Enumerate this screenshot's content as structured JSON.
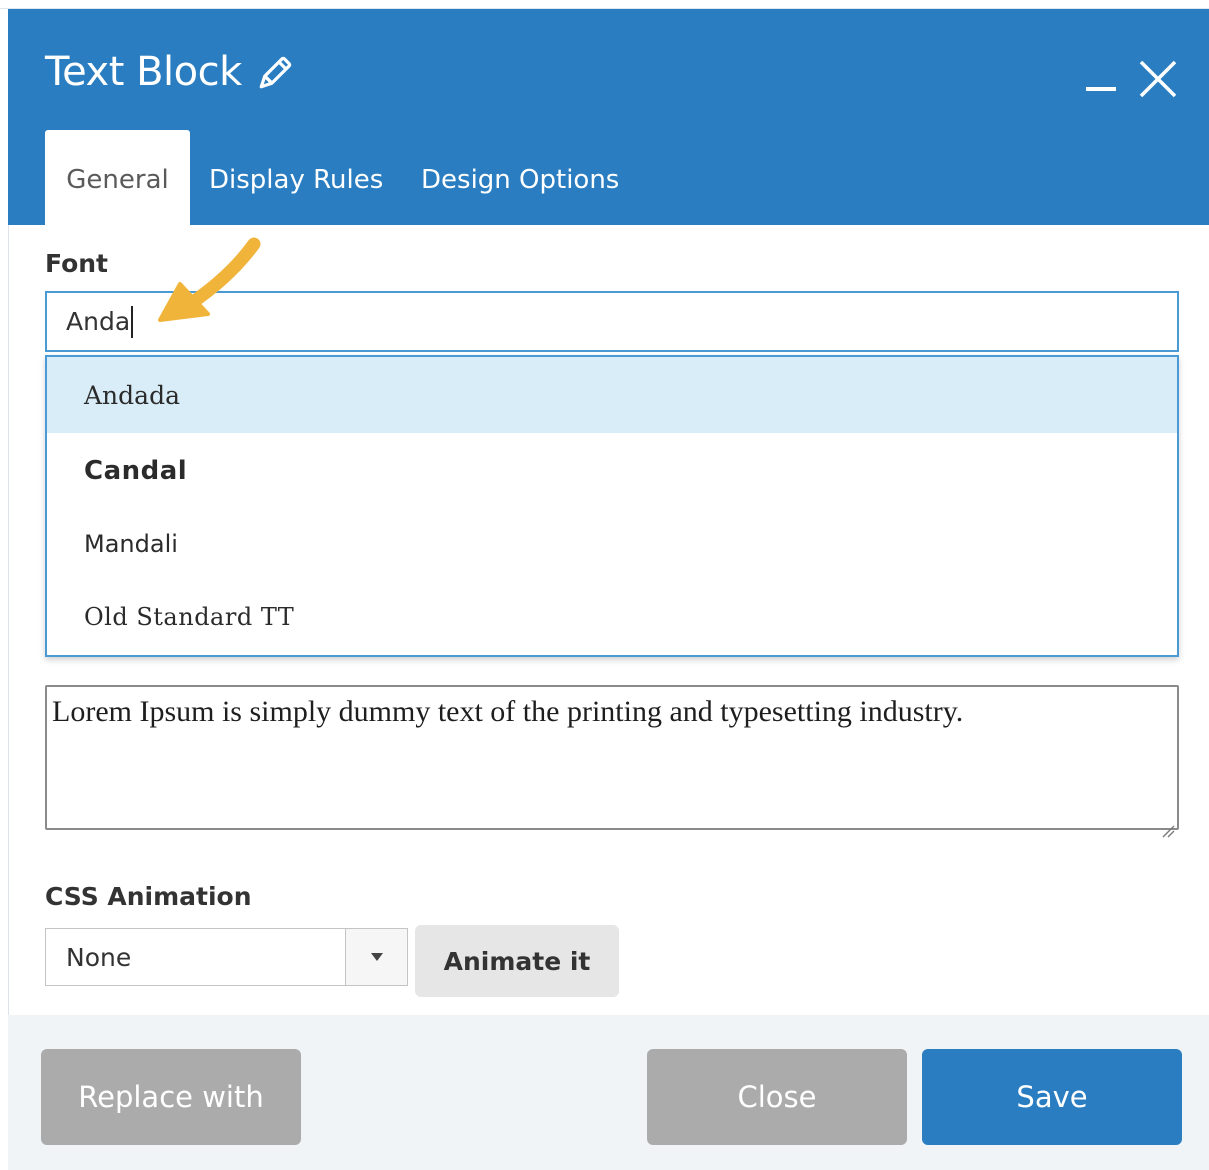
{
  "dialog": {
    "title": "Text Block",
    "title_icon": "pencil-icon",
    "minimize_icon": "minimize-icon",
    "close_icon": "close-icon"
  },
  "tabs": [
    {
      "label": "General",
      "active": true
    },
    {
      "label": "Display Rules",
      "active": false
    },
    {
      "label": "Design Options",
      "active": false
    }
  ],
  "font_field": {
    "label": "Font",
    "value": "Anda"
  },
  "font_suggestions": [
    {
      "label": "Andada",
      "highlighted": true
    },
    {
      "label": "Candal",
      "highlighted": false
    },
    {
      "label": "Mandali",
      "highlighted": false
    },
    {
      "label": "Old Standard TT",
      "highlighted": false
    }
  ],
  "text_content": "Lorem Ipsum is simply dummy text of the printing and typesetting industry.",
  "css_animation": {
    "label": "CSS Animation",
    "selected": "None",
    "animate_button": "Animate it"
  },
  "footer": {
    "replace_label": "Replace with",
    "close_label": "Close",
    "save_label": "Save"
  },
  "colors": {
    "header_blue": "#2a7dc1",
    "highlight": "#d8edf8",
    "annotation_arrow": "#f0b43a",
    "disabled_gray": "#ababab"
  }
}
